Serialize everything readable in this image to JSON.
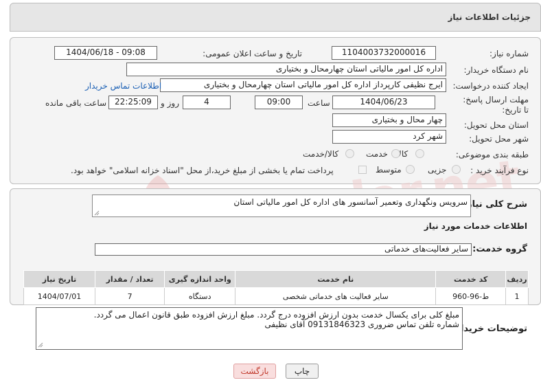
{
  "header": {
    "title": "جزئیات اطلاعات نیاز"
  },
  "form": {
    "need_number_label": "شماره نیاز:",
    "need_number": "1104003732000016",
    "announce_label": "تاریخ و ساعت اعلان عمومی:",
    "announce_value": "1404/06/18 - 09:08",
    "buyer_label": "نام دستگاه خریدار:",
    "buyer_value": "اداره کل امور مالیاتی استان چهارمحال و بختیاری",
    "requester_label": "ایجاد کننده درخواست:",
    "requester_value": "ایرج نظیفی کارپرداز اداره کل امور مالیاتی استان چهارمحال و بختیاری",
    "contact_link": "اطلاعات تماس خریدار",
    "deadline_label": "مهلت ارسال پاسخ: تا تاریخ:",
    "deadline_date": "1404/06/23",
    "time_label": "ساعت",
    "deadline_time": "09:00",
    "days_value": "4",
    "days_label": "روز و",
    "remaining_time": "22:25:09",
    "remaining_label": "ساعت باقی مانده",
    "province_label": "استان محل تحویل:",
    "province_value": "چهار محال و بختیاری",
    "city_label": "شهر محل تحویل:",
    "city_value": "شهر کرد",
    "category_label": "طبقه بندی موضوعی:",
    "category_options": [
      "کالا",
      "خدمت",
      "کالا/خدمت"
    ],
    "process_label": "نوع فرآیند خرید :",
    "process_options": [
      "جزیی",
      "متوسط"
    ],
    "payment_note": "پرداخت تمام یا بخشی از مبلغ خرید،از محل \"اسناد خزانه اسلامی\" خواهد بود."
  },
  "description": {
    "label": "شرح کلی نیاز:",
    "value": "سرویس ونگهداری وتعمیر آسانسور های اداره کل امور مالیاتی استان"
  },
  "services": {
    "section_title": "اطلاعات خدمات مورد نیاز",
    "group_label": "گروه خدمت:",
    "group_value": "سایر فعالیت‌های خدماتی",
    "columns": [
      "ردیف",
      "کد خدمت",
      "نام خدمت",
      "واحد اندازه گیری",
      "تعداد / مقدار",
      "تاریخ نیاز"
    ],
    "rows": [
      {
        "index": "1",
        "code": "ط-96-960",
        "name": "سایر فعالیت های خدماتی شخصی",
        "unit": "دستگاه",
        "qty": "7",
        "date": "1404/07/01"
      }
    ]
  },
  "buyer_notes": {
    "label": "توضیحات خریدار:",
    "line1": "مبلغ کلی برای یکسال خدمت بدون ارزش افزوده درج گردد. مبلغ ارزش افزوده طبق قانون اعمال می گردد.",
    "line2": "شماره تلفن تماس ضروری 09131846323   آقای نظیفی"
  },
  "buttons": {
    "print": "چاپ",
    "back": "بازگشت"
  },
  "watermark": "AriaTender.net",
  "colors": {
    "link": "#1a5fb4",
    "back_button_text": "#c0392b",
    "back_button_bg": "#f9dede"
  }
}
